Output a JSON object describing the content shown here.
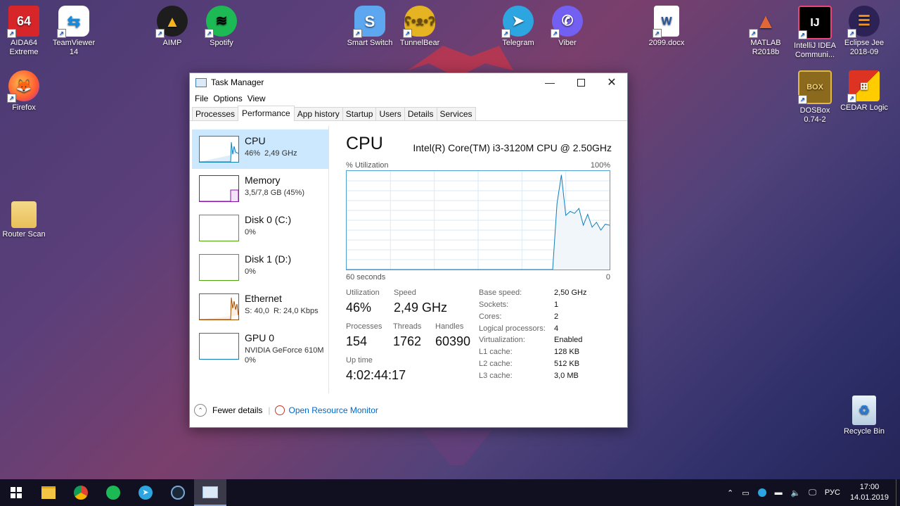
{
  "desktop_icons": [
    {
      "label": "AIDA64\nExtreme",
      "icon": "aida64-icon"
    },
    {
      "label": "TeamViewer\n14",
      "icon": "teamviewer-icon"
    },
    {
      "label": "AIMP",
      "icon": "aimp-icon"
    },
    {
      "label": "Spotify",
      "icon": "spotify-icon"
    },
    {
      "label": "Smart Switch",
      "icon": "smart-switch-icon"
    },
    {
      "label": "TunnelBear",
      "icon": "tunnelbear-icon"
    },
    {
      "label": "Telegram",
      "icon": "telegram-icon"
    },
    {
      "label": "Viber",
      "icon": "viber-icon"
    },
    {
      "label": "2099.docx",
      "icon": "word-document-icon"
    },
    {
      "label": "MATLAB\nR2018b",
      "icon": "matlab-icon"
    },
    {
      "label": "IntelliJ IDEA\nCommuni...",
      "icon": "intellij-icon"
    },
    {
      "label": "Eclipse Jee\n2018-09",
      "icon": "eclipse-icon"
    },
    {
      "label": "Firefox",
      "icon": "firefox-icon"
    },
    {
      "label": "DOSBox\n0.74-2",
      "icon": "dosbox-icon"
    },
    {
      "label": "CEDAR Logic",
      "icon": "cedar-logic-icon"
    },
    {
      "label": "Router Scan",
      "icon": "folder-icon"
    },
    {
      "label": "Recycle Bin",
      "icon": "recycle-bin-icon"
    }
  ],
  "window": {
    "title": "Task Manager",
    "menu": [
      "File",
      "Options",
      "View"
    ],
    "tabs": [
      "Processes",
      "Performance",
      "App history",
      "Startup",
      "Users",
      "Details",
      "Services"
    ],
    "active_tab": "Performance"
  },
  "sidebar": [
    {
      "name": "CPU",
      "sub": "46%  2,49 GHz",
      "color": "#117dbb"
    },
    {
      "name": "Memory",
      "sub": "3,5/7,8 GB (45%)",
      "color": "#8b12ae"
    },
    {
      "name": "Disk 0 (C:)",
      "sub": "0%",
      "color": "#4da60c"
    },
    {
      "name": "Disk 1 (D:)",
      "sub": "0%",
      "color": "#4da60c"
    },
    {
      "name": "Ethernet",
      "sub": "S: 40,0  R: 24,0 Kbps",
      "color": "#a74f01"
    },
    {
      "name": "GPU 0",
      "sub": "NVIDIA GeForce 610M\n0%",
      "color": "#117dbb"
    }
  ],
  "cpu": {
    "title": "CPU",
    "model": "Intel(R) Core(TM) i3-3120M CPU @ 2.50GHz",
    "graph_label": "% Utilization",
    "graph_max": "100%",
    "graph_time": "60 seconds",
    "graph_min": "0",
    "utilization_label": "Utilization",
    "utilization": "46%",
    "speed_label": "Speed",
    "speed": "2,49 GHz",
    "processes_label": "Processes",
    "processes": "154",
    "threads_label": "Threads",
    "threads": "1762",
    "handles_label": "Handles",
    "handles": "60390",
    "uptime_label": "Up time",
    "uptime": "4:02:44:17",
    "details": [
      {
        "k": "Base speed:",
        "v": "2,50 GHz"
      },
      {
        "k": "Sockets:",
        "v": "1"
      },
      {
        "k": "Cores:",
        "v": "2"
      },
      {
        "k": "Logical processors:",
        "v": "4"
      },
      {
        "k": "Virtualization:",
        "v": "Enabled"
      },
      {
        "k": "L1 cache:",
        "v": "128 KB"
      },
      {
        "k": "L2 cache:",
        "v": "512 KB"
      },
      {
        "k": "L3 cache:",
        "v": "3,0 MB"
      }
    ]
  },
  "chart_data": {
    "type": "area",
    "x": [
      0,
      1,
      2,
      3,
      4,
      5,
      6,
      7,
      8,
      9,
      10,
      11,
      12,
      13,
      14,
      15,
      16,
      17,
      18,
      19,
      20,
      21,
      22,
      23,
      24,
      25,
      26,
      27,
      28,
      29,
      30,
      31,
      32,
      33,
      34,
      35,
      36,
      37,
      38,
      39,
      40,
      41,
      42,
      43,
      44,
      45,
      46,
      47,
      48,
      49,
      50,
      51,
      52,
      53,
      54,
      55,
      56,
      57,
      58,
      59,
      60
    ],
    "series": [
      {
        "values": [
          0,
          0,
          0,
          0,
          0,
          0,
          0,
          0,
          0,
          0,
          0,
          0,
          0,
          0,
          0,
          0,
          0,
          0,
          0,
          0,
          0,
          0,
          0,
          0,
          0,
          0,
          0,
          0,
          0,
          0,
          0,
          0,
          0,
          0,
          0,
          0,
          0,
          0,
          0,
          0,
          0,
          0,
          0,
          0,
          0,
          0,
          0,
          0,
          0,
          0,
          0,
          0,
          0,
          0,
          0,
          0,
          0,
          0,
          0,
          0,
          0
        ]
      }
    ],
    "live_values": [
      0,
      0,
      0,
      0,
      0,
      0,
      0,
      0,
      0,
      0,
      0,
      0,
      0,
      0,
      0,
      0,
      0,
      0,
      0,
      0,
      0,
      0,
      0,
      0,
      0,
      0,
      0,
      0,
      0,
      0,
      0,
      0,
      0,
      0,
      0,
      0,
      0,
      0,
      0,
      0,
      0,
      0,
      0,
      0,
      0,
      0,
      0,
      0,
      0,
      0,
      0,
      0,
      0,
      0,
      0,
      0,
      0,
      0,
      0,
      0,
      0
    ],
    "tail": [
      0,
      67,
      96,
      55,
      59,
      57,
      62,
      45,
      56,
      43,
      48,
      40,
      46,
      45
    ],
    "xlabel": "60 seconds",
    "ylabel": "% Utilization",
    "ylim": [
      0,
      100
    ]
  },
  "fewer_details": "Fewer details",
  "open_resource_monitor": "Open Resource Monitor",
  "taskbar": {
    "apps": [
      "start-icon",
      "file-explorer-icon",
      "chrome-icon",
      "spotify-icon",
      "telegram-icon",
      "steam-icon",
      "task-manager-icon"
    ],
    "language": "РУС",
    "time": "17:00",
    "date": "14.01.2019"
  }
}
